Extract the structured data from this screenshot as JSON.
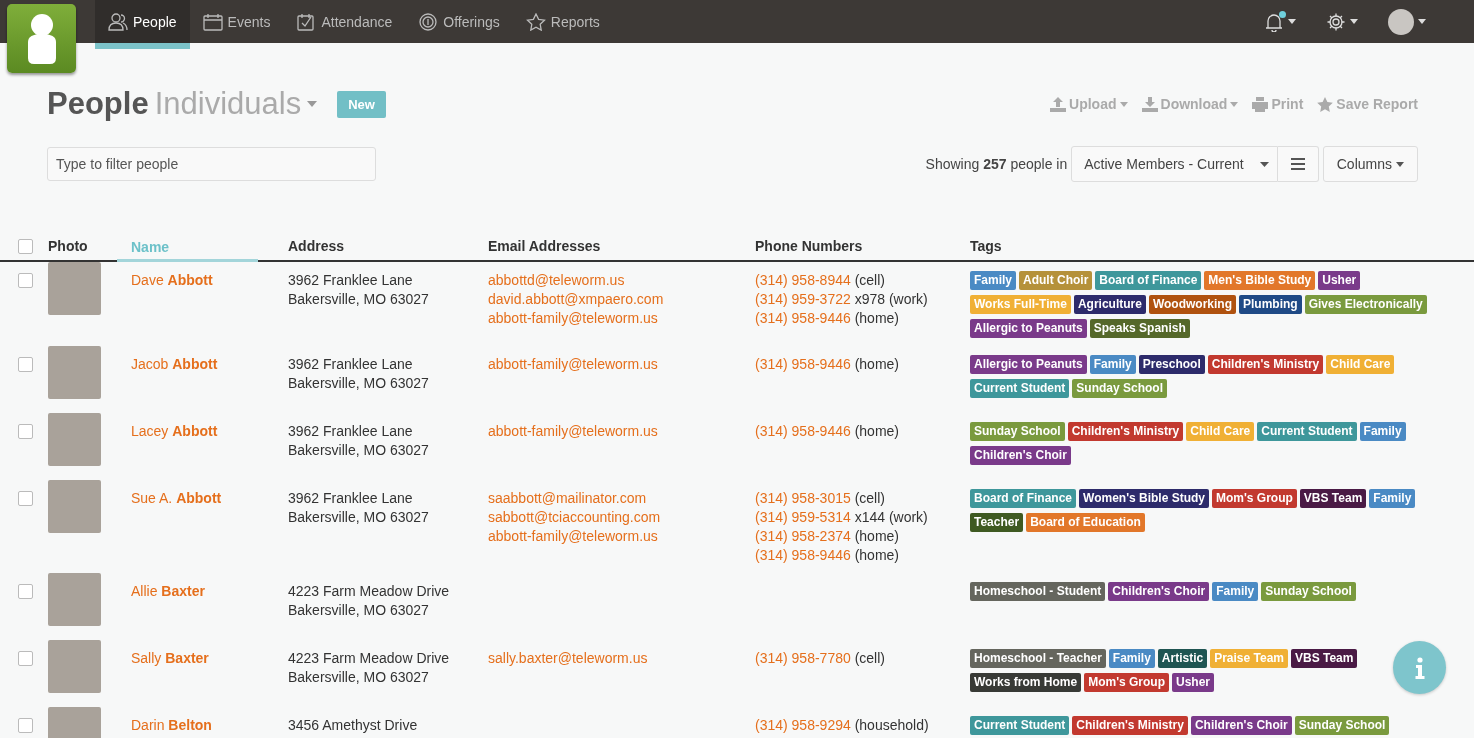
{
  "nav": {
    "tabs": [
      {
        "label": "People",
        "selected": true
      },
      {
        "label": "Events",
        "selected": false
      },
      {
        "label": "Attendance",
        "selected": false
      },
      {
        "label": "Offerings",
        "selected": false
      },
      {
        "label": "Reports",
        "selected": false
      }
    ],
    "notifications_unread": true
  },
  "header": {
    "title": "People",
    "subtitle": "Individuals",
    "new_button": "New",
    "actions": [
      {
        "label": "Upload",
        "dropdown": true
      },
      {
        "label": "Download",
        "dropdown": true
      },
      {
        "label": "Print",
        "dropdown": false
      },
      {
        "label": "Save Report",
        "dropdown": false
      }
    ]
  },
  "filter": {
    "placeholder": "Type to filter people"
  },
  "summary": "Showing **257** people in",
  "list_select": "Active Members - Current",
  "columns_button": "Columns",
  "table": {
    "select_all": false,
    "columns": [
      {
        "label": "Photo",
        "sorted": false
      },
      {
        "label": "Name",
        "sorted": true
      },
      {
        "label": "Address",
        "sorted": false
      },
      {
        "label": "Email Addresses",
        "sorted": false
      },
      {
        "label": "Phone Numbers",
        "sorted": false
      },
      {
        "label": "Tags",
        "sorted": false
      }
    ],
    "rows": [
      {
        "checked": false,
        "name": "Dave **Abbott**",
        "address": [
          "3962 Franklee Lane",
          "Bakersville, MO   63027"
        ],
        "emails": [
          "abbottd@teleworm.us",
          "david.abbott@xmpaero.com",
          "abbott-family@teleworm.us"
        ],
        "phones": [
          {
            "number": "(314) 958-8944",
            "note": "(cell)"
          },
          {
            "number": "(314) 959-3722",
            "note": "x978 (work)"
          },
          {
            "number": "(314) 958-9446",
            "note": "(home)"
          }
        ],
        "tags": [
          {
            "label": "Family",
            "color": "#4a8ac4"
          },
          {
            "label": "Adult Choir",
            "color": "#b5913a"
          },
          {
            "label": "Board of Finance",
            "color": "#3e979b"
          },
          {
            "label": "Men's Bible Study",
            "color": "#e2772a"
          },
          {
            "label": "Usher",
            "color": "#7a3a8a"
          },
          {
            "label": "Works Full-Time",
            "color": "#f0b035"
          },
          {
            "label": "Agriculture",
            "color": "#2d2b6b"
          },
          {
            "label": "Woodworking",
            "color": "#b0520f"
          },
          {
            "label": "Plumbing",
            "color": "#1f4a86"
          },
          {
            "label": "Gives Electronically",
            "color": "#7a9a3e"
          },
          {
            "label": "Allergic to Peanuts",
            "color": "#7a3a8a"
          },
          {
            "label": "Speaks Spanish",
            "color": "#55682a"
          }
        ]
      },
      {
        "checked": false,
        "name": "Jacob **Abbott**",
        "address": [
          "3962 Franklee Lane",
          "Bakersville, MO   63027"
        ],
        "emails": [
          "abbott-family@teleworm.us"
        ],
        "phones": [
          {
            "number": "(314) 958-9446",
            "note": "(home)"
          }
        ],
        "tags": [
          {
            "label": "Allergic to Peanuts",
            "color": "#7a3a8a"
          },
          {
            "label": "Family",
            "color": "#4a8ac4"
          },
          {
            "label": "Preschool",
            "color": "#2d2b6b"
          },
          {
            "label": "Children's Ministry",
            "color": "#c2392f"
          },
          {
            "label": "Child Care",
            "color": "#f0b035"
          },
          {
            "label": "Current Student",
            "color": "#3e979b"
          },
          {
            "label": "Sunday School",
            "color": "#7a9a3e"
          }
        ]
      },
      {
        "checked": false,
        "name": "Lacey **Abbott**",
        "address": [
          "3962 Franklee Lane",
          "Bakersville, MO   63027"
        ],
        "emails": [
          "abbott-family@teleworm.us"
        ],
        "phones": [
          {
            "number": "(314) 958-9446",
            "note": "(home)"
          }
        ],
        "tags": [
          {
            "label": "Sunday School",
            "color": "#7a9a3e"
          },
          {
            "label": "Children's Ministry",
            "color": "#c2392f"
          },
          {
            "label": "Child Care",
            "color": "#f0b035"
          },
          {
            "label": "Current Student",
            "color": "#3e979b"
          },
          {
            "label": "Family",
            "color": "#4a8ac4"
          },
          {
            "label": "Children's Choir",
            "color": "#7a3a8a"
          }
        ]
      },
      {
        "checked": false,
        "name": "Sue A. **Abbott**",
        "address": [
          "3962 Franklee Lane",
          "Bakersville, MO   63027"
        ],
        "emails": [
          "saabbott@mailinator.com",
          "sabbott@tciaccounting.com",
          "abbott-family@teleworm.us"
        ],
        "phones": [
          {
            "number": "(314) 958-3015",
            "note": "(cell)"
          },
          {
            "number": "(314) 959-5314",
            "note": "x144 (work)"
          },
          {
            "number": "(314) 958-2374",
            "note": "(home)"
          },
          {
            "number": "(314) 958-9446",
            "note": "(home)"
          }
        ],
        "tags": [
          {
            "label": "Board of Finance",
            "color": "#3e979b"
          },
          {
            "label": "Women's Bible Study",
            "color": "#2d2b6b"
          },
          {
            "label": "Mom's Group",
            "color": "#c2392f"
          },
          {
            "label": "VBS Team",
            "color": "#4a1a45"
          },
          {
            "label": "Family",
            "color": "#4a8ac4"
          },
          {
            "label": "Teacher",
            "color": "#3f5a22"
          },
          {
            "label": "Board of Education",
            "color": "#e2772a"
          }
        ]
      },
      {
        "checked": false,
        "name": "Allie **Baxter**",
        "address": [
          "4223 Farm Meadow Drive",
          "Bakersville, MO   63027"
        ],
        "emails": [],
        "phones": [],
        "tags": [
          {
            "label": "Homeschool - Student",
            "color": "#65665e"
          },
          {
            "label": "Children's Choir",
            "color": "#7a3a8a"
          },
          {
            "label": "Family",
            "color": "#4a8ac4"
          },
          {
            "label": "Sunday School",
            "color": "#7a9a3e"
          }
        ]
      },
      {
        "checked": false,
        "name": "Sally **Baxter**",
        "address": [
          "4223 Farm Meadow Drive",
          "Bakersville, MO   63027"
        ],
        "emails": [
          "sally.baxter@teleworm.us"
        ],
        "phones": [
          {
            "number": "(314) 958-7780",
            "note": "(cell)"
          }
        ],
        "tags": [
          {
            "label": "Homeschool - Teacher",
            "color": "#65665e"
          },
          {
            "label": "Family",
            "color": "#4a8ac4"
          },
          {
            "label": "Artistic",
            "color": "#1f5552"
          },
          {
            "label": "Praise Team",
            "color": "#f0b035"
          },
          {
            "label": "VBS Team",
            "color": "#4a1a45"
          },
          {
            "label": "Works from Home",
            "color": "#383a36"
          },
          {
            "label": "Mom's Group",
            "color": "#c2392f"
          },
          {
            "label": "Usher",
            "color": "#7a3a8a"
          }
        ]
      },
      {
        "checked": false,
        "name": "Darin **Belton**",
        "address": [
          "3456 Amethyst Drive"
        ],
        "emails": [],
        "phones": [
          {
            "number": "(314) 958-9294",
            "note": "(household)"
          }
        ],
        "tags": [
          {
            "label": "Current Student",
            "color": "#3e979b"
          },
          {
            "label": "Children's Ministry",
            "color": "#c2392f"
          },
          {
            "label": "Children's Choir",
            "color": "#7a3a8a"
          },
          {
            "label": "Sunday School",
            "color": "#7a9a3e"
          }
        ]
      }
    ]
  }
}
